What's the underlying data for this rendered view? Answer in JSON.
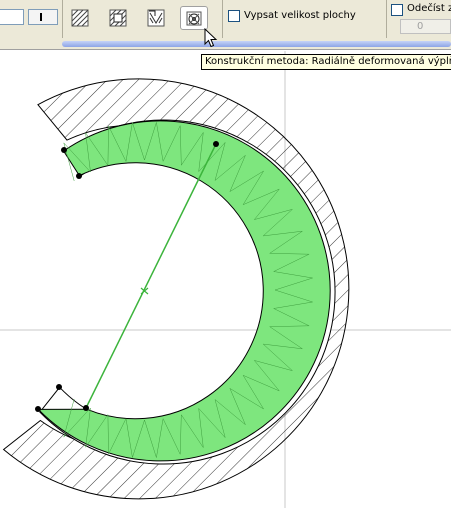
{
  "toolbar": {
    "display_area_label": "Vypsat velikost plochy",
    "subtract_label": "Odečíst z",
    "subtract_value": "0",
    "fill_methods": [
      {
        "icon": "linear-fill-icon"
      },
      {
        "icon": "radial-fill-icon"
      },
      {
        "icon": "distorted-fill-icon"
      },
      {
        "icon": "radial-distorted-fill-icon",
        "active": true
      }
    ]
  },
  "tooltip": {
    "text": "Konstrukční metoda: Radiálně deformovaná výplň"
  },
  "colors": {
    "fill_green": "#7ee67e",
    "axis_green": "#3cb43c",
    "toolbar_bg": "#ece9d8",
    "tooltip_bg": "#ffffe1"
  }
}
